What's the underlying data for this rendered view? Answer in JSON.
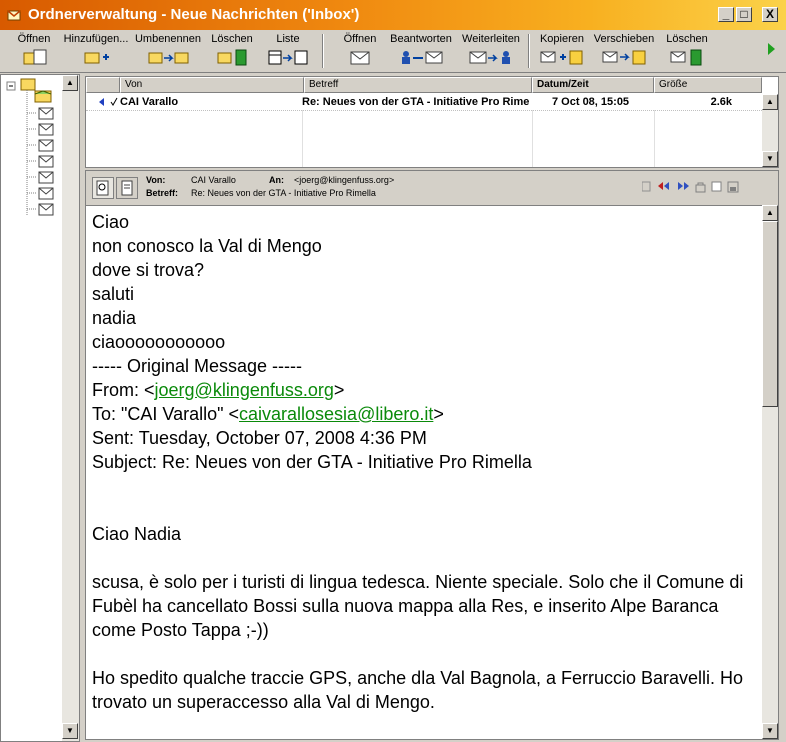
{
  "window": {
    "title": "Ordnerverwaltung - Neue Nachrichten ('Inbox')",
    "minimize": "_",
    "maximize": "□",
    "close": "X"
  },
  "toolbar": {
    "open_folder": "Öffnen",
    "add": "Hinzufügen...",
    "rename": "Umbenennen",
    "delete_folder": "Löschen",
    "list": "Liste",
    "open_msg": "Öffnen",
    "reply": "Beantworten",
    "forward": "Weiterleiten",
    "copy": "Kopieren",
    "move": "Verschieben",
    "delete_msg": "Löschen"
  },
  "list": {
    "columns": [
      "Von",
      "Betreff",
      "Datum/Zeit",
      "Größe"
    ],
    "rows": [
      {
        "from": "CAI Varallo",
        "subject": "Re: Neues von der GTA - Initiative Pro Rimella",
        "date": "7 Oct 08, 15:05",
        "size": "2.6k"
      }
    ]
  },
  "preview": {
    "from_label": "Von:",
    "from_value": "CAI Varallo",
    "to_label": "An:",
    "to_value": "<joerg@klingenfuss.org>",
    "subject_label": "Betreff:",
    "subject_value": "Re: Neues von der GTA - Initiative Pro Rimella"
  },
  "body": {
    "l1": "Ciao",
    "l2": "non conosco  la Val di Mengo",
    "l3": "dove si trova?",
    "l4": "saluti",
    "l5": "nadia",
    "l6": "ciaooooooooooo",
    "l7": "----- Original Message -----",
    "from_prefix": "From: <",
    "from_email": "joerg@klingenfuss.org",
    "from_suffix": ">",
    "to_prefix": "To: \"CAI Varallo\" <",
    "to_email": "caivarallosesia@libero.it",
    "to_suffix": ">",
    "sent": "Sent: Tuesday, October 07, 2008 4:36 PM",
    "subject": "Subject: Re: Neues von der GTA - Initiative Pro Rimella",
    "greeting": "Ciao Nadia",
    "p1": "scusa, è solo per i turisti di lingua tedesca. Niente speciale. Solo che il Comune di Fubèl ha cancellato Bossi sulla nuova mappa alla Res, e inserito Alpe Baranca come Posto Tappa ;-))",
    "p2": "Ho spedito qualche traccie GPS, anche dla Val Bagnola, a Ferruccio Baravelli. Ho trovato un superaccesso alla Val di Mengo."
  }
}
